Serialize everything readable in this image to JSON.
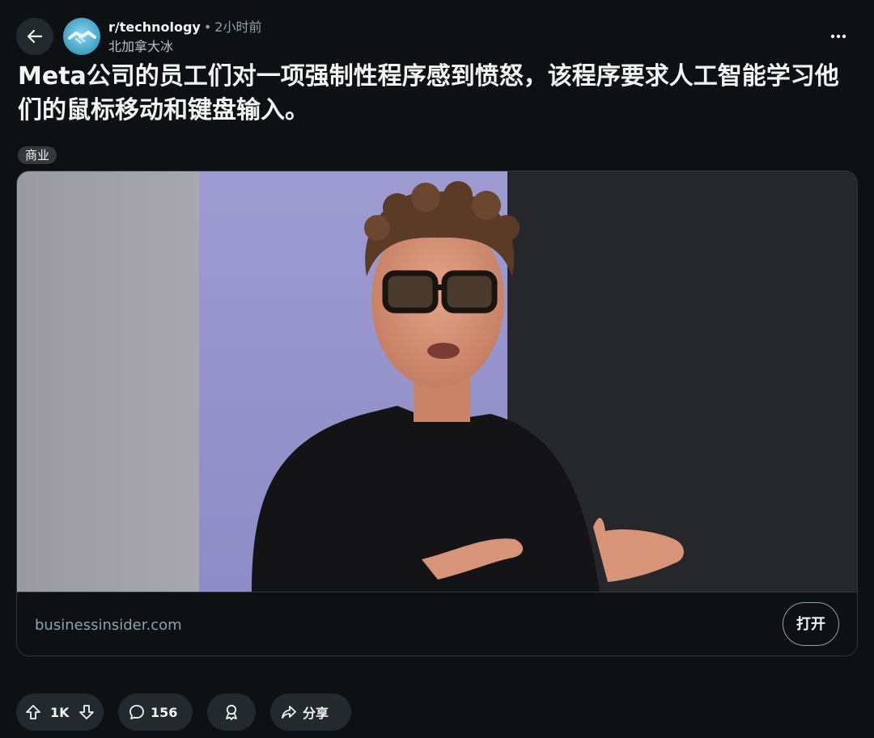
{
  "post": {
    "subreddit": "r/technology",
    "separator": "•",
    "time": "2小时前",
    "author": "北加拿大冰",
    "title": "Meta公司的员工们对一项强制性程序感到愤怒，该程序要求人工智能学习他们的鼠标移动和键盘输入。",
    "flair": "商业"
  },
  "card": {
    "domain": "businessinsider.com",
    "open_label": "打开"
  },
  "actions": {
    "votes": "1K",
    "comments": "156",
    "share_label": "分享"
  },
  "icons": {
    "back": "back-arrow-icon",
    "more": "more-dots-icon",
    "upvote": "upvote-arrow-icon",
    "downvote": "downvote-arrow-icon",
    "comment": "comment-bubble-icon",
    "award": "award-ribbon-icon",
    "share": "share-arrow-icon"
  },
  "colors": {
    "background": "#0e1113",
    "button_bg": "#23292d",
    "muted_text": "#8ba2ad",
    "border": "#2e3437"
  }
}
